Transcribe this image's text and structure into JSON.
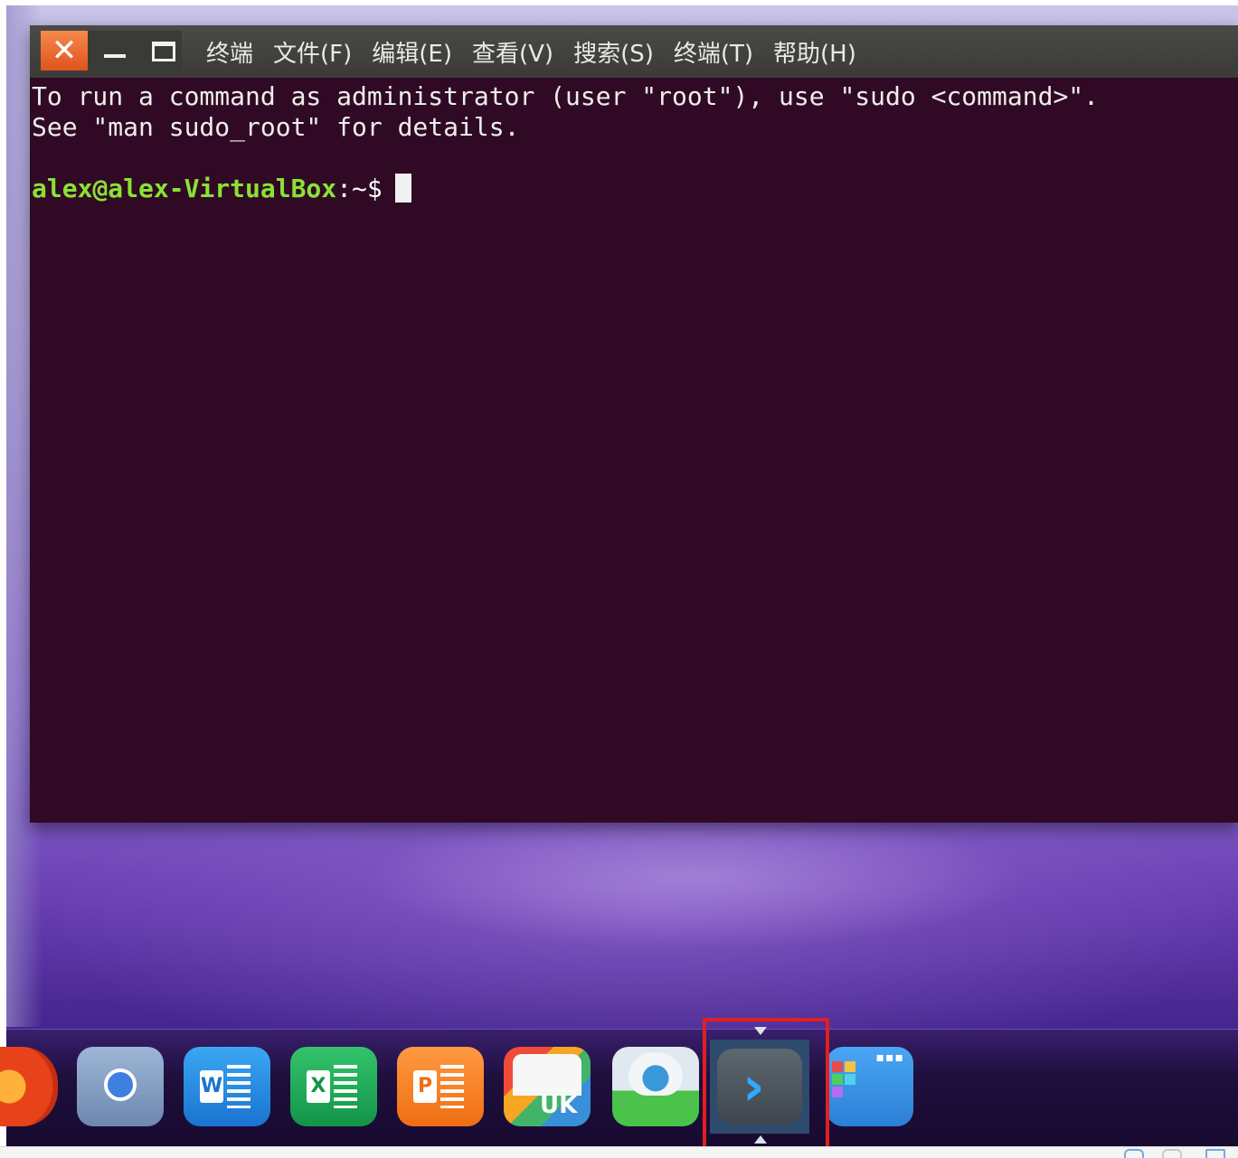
{
  "terminal": {
    "window_title": "终端",
    "menu": [
      "文件(F)",
      "编辑(E)",
      "查看(V)",
      "搜索(S)",
      "终端(T)",
      "帮助(H)"
    ],
    "lines": [
      "To run a command as administrator (user \"root\"), use \"sudo <command>\".",
      "See \"man sudo_root\" for details."
    ],
    "prompt_user": "alex@alex-VirtualBox",
    "prompt_path": ":~$",
    "close_glyph": "✕"
  },
  "dock": {
    "items": [
      {
        "name": "firefox-icon"
      },
      {
        "name": "chromium-icon"
      },
      {
        "name": "word-icon",
        "letter": "W"
      },
      {
        "name": "excel-icon",
        "letter": "X"
      },
      {
        "name": "powerpoint-icon",
        "letter": "P"
      },
      {
        "name": "ubuntu-kylin-software-icon",
        "text": "UK"
      },
      {
        "name": "mascot-app-icon"
      },
      {
        "name": "terminal-icon",
        "glyph": "›",
        "active": true
      },
      {
        "name": "app-launcher-icon",
        "dots": "▪▪▪"
      }
    ],
    "highlight_color": "#e02020"
  },
  "colors": {
    "terminal_bg": "#300a24",
    "prompt_user": "#8ae234",
    "accent_close": "#e0531f"
  }
}
